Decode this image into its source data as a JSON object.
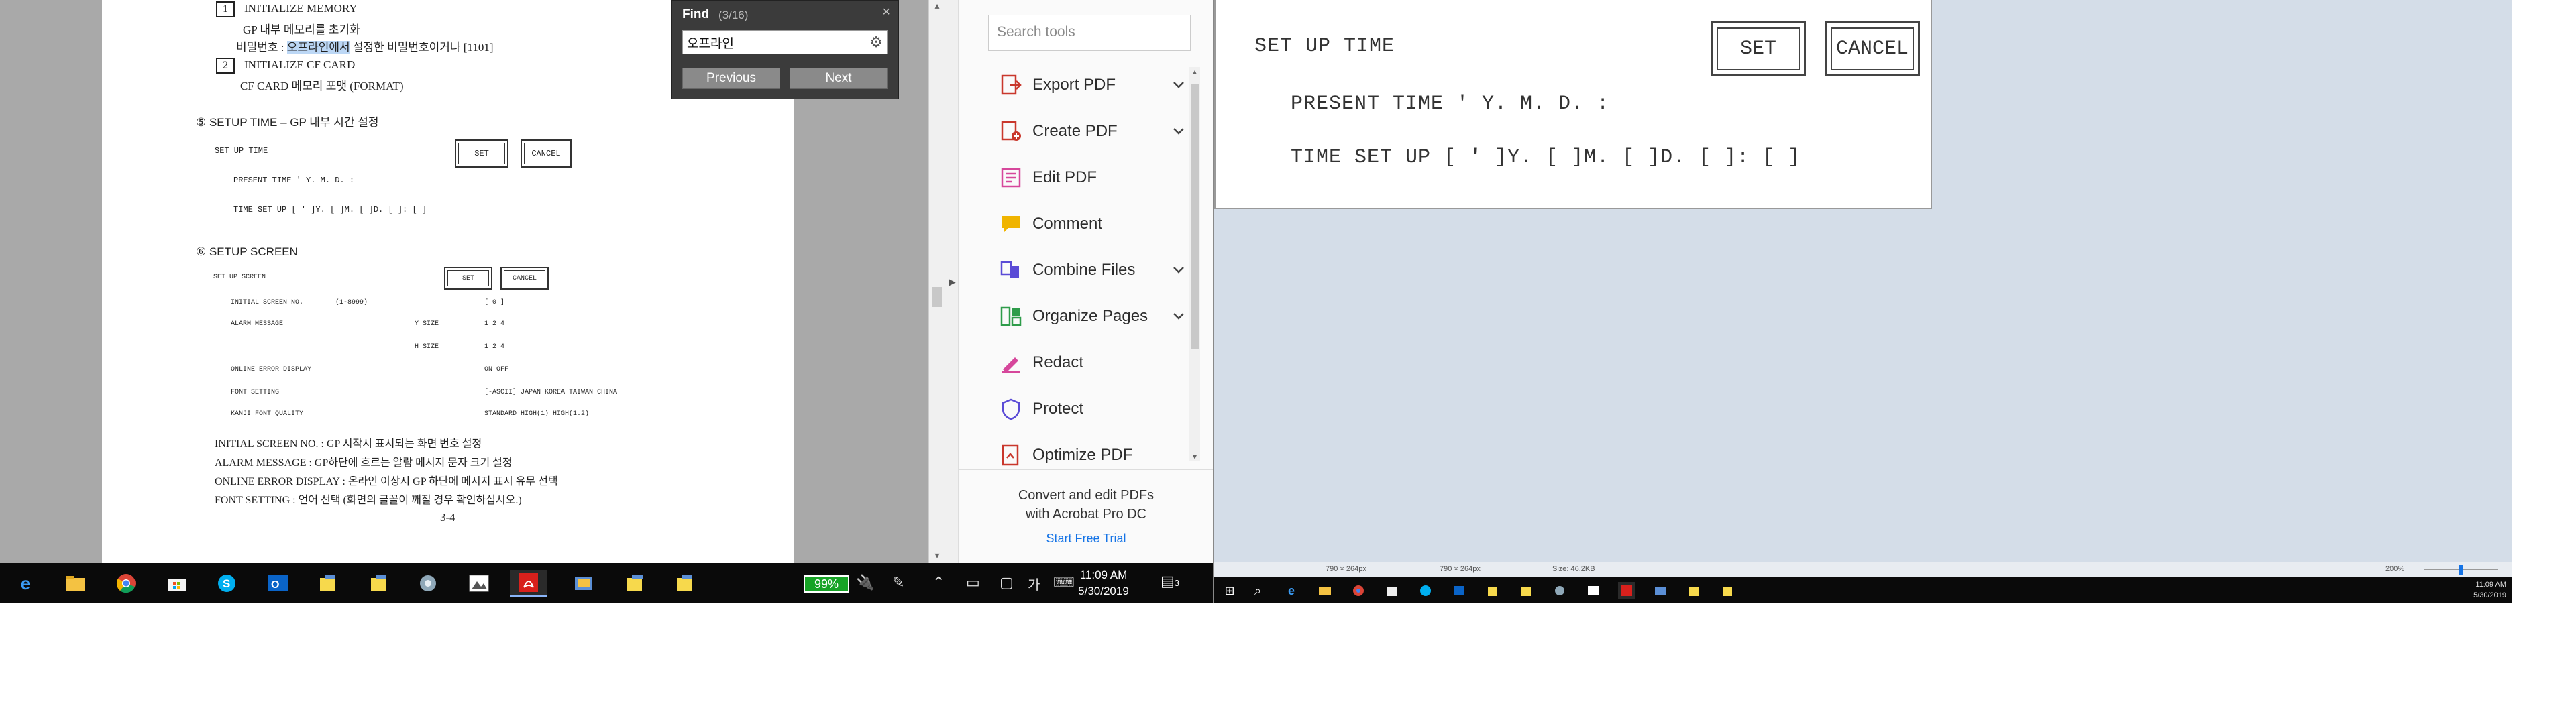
{
  "left_doc": {
    "item1_num": "1",
    "item1_title": "INITIALIZE MEMORY",
    "item1_line2": "GP 내부 메모리를 초기화",
    "item1_line3_a": "비밀번호 : ",
    "item1_line3_highlight": "오프라인에서",
    "item1_line3_b": " 설정한 비밀번호이거나 [1101]",
    "item2_num": "2",
    "item2_title": "INITIALIZE CF CARD",
    "item2_line2": "CF CARD 메모리 포맷 (FORMAT)",
    "section5": "⑤ SETUP TIME – GP 내부 시간 설정",
    "setup_time_label": "SET UP TIME",
    "set_btn": "SET",
    "cancel_btn": "CANCEL",
    "present_time": "PRESENT TIME  ' Y.  M.  D.    :",
    "time_set_up": "TIME SET UP  [ ' ]Y.  [  ]M.  [  ]D.  [  ]:  [  ]",
    "section6": "⑥ SETUP SCREEN",
    "setup_screen_label": "SET UP SCREEN",
    "set_btn_small": "SET",
    "cancel_btn_small": "CANCEL",
    "rows": [
      {
        "label": "INITIAL SCREEN NO.",
        "mid": "(1-8999)",
        "value": "[ 0    ]"
      },
      {
        "label": "ALARM MESSAGE",
        "mid": "Y SIZE",
        "value": "1     2     4"
      },
      {
        "label": "",
        "mid": "H SIZE",
        "value": "1     2     4"
      },
      {
        "label": "ONLINE ERROR DISPLAY",
        "mid": "",
        "value": "ON   OFF"
      },
      {
        "label": "FONT SETTING",
        "mid": "",
        "value": "[-ASCII] JAPAN  KOREA  TAIWAN  CHINA"
      },
      {
        "label": "KANJI FONT QUALITY",
        "mid": "",
        "value": "STANDARD     HIGH(1)     HIGH(1.2)"
      }
    ],
    "notes": [
      "INITIAL SCREEN NO. : GP 시작시 표시되는 화면 번호 설정",
      "ALARM MESSAGE : GP하단에 흐르는 알람 메시지 문자 크기 설정",
      "ONLINE ERROR DISPLAY : 온라인 이상시 GP 하단에 메시지 표시 유무 선택",
      "FONT SETTING : 언어 선택 (화면의 글꼴이 깨질 경우 확인하십시오.)"
    ],
    "page_number": "3-4"
  },
  "find": {
    "title": "Find",
    "count": "(3/16)",
    "query": "오프라인",
    "previous": "Previous",
    "next": "Next",
    "close_glyph": "×"
  },
  "tools": {
    "search_placeholder": "Search tools",
    "items": [
      {
        "label": "Export PDF",
        "icon": "export-pdf-icon",
        "color": "#c9372c",
        "chevron": true
      },
      {
        "label": "Create PDF",
        "icon": "create-pdf-icon",
        "color": "#c9372c",
        "chevron": true
      },
      {
        "label": "Edit PDF",
        "icon": "edit-pdf-icon",
        "color": "#d6479b",
        "chevron": false
      },
      {
        "label": "Comment",
        "icon": "comment-icon",
        "color": "#f0b400",
        "chevron": false
      },
      {
        "label": "Combine Files",
        "icon": "combine-files-icon",
        "color": "#5a4bd6",
        "chevron": true
      },
      {
        "label": "Organize Pages",
        "icon": "organize-pages-icon",
        "color": "#2e9c4a",
        "chevron": true
      },
      {
        "label": "Redact",
        "icon": "redact-icon",
        "color": "#d6479b",
        "chevron": false
      },
      {
        "label": "Protect",
        "icon": "protect-icon",
        "color": "#5a4bd6",
        "chevron": false
      },
      {
        "label": "Optimize PDF",
        "icon": "optimize-pdf-icon",
        "color": "#c9372c",
        "chevron": false
      }
    ],
    "promo_text": "Convert and edit PDFs\nwith Acrobat Pro DC",
    "promo_link": "Start Free Trial"
  },
  "taskbar_left": {
    "battery": "99%",
    "ime": "가",
    "time": "11:09 AM",
    "date": "5/30/2019",
    "notifications": "3"
  },
  "right_zoom": {
    "title": "SET UP TIME",
    "set": "SET",
    "cancel": "CANCEL",
    "present_time": "PRESENT TIME  ' Y.  M.  D.    :",
    "time_set_up": "TIME SET UP  [ ' ]Y.  [  ]M.  [  ]D.  [  ]:  [  ]"
  },
  "right_status": {
    "dim1": "790 × 264px",
    "dim2": "790 × 264px",
    "size": "Size: 46.2KB",
    "zoom": "200%"
  },
  "taskbar_right": {
    "time": "11:09 AM",
    "date": "5/30/2019"
  },
  "colors": {
    "accent": "#1473e6",
    "taskbar": "#0a0a0a",
    "battery": "#16a325"
  }
}
